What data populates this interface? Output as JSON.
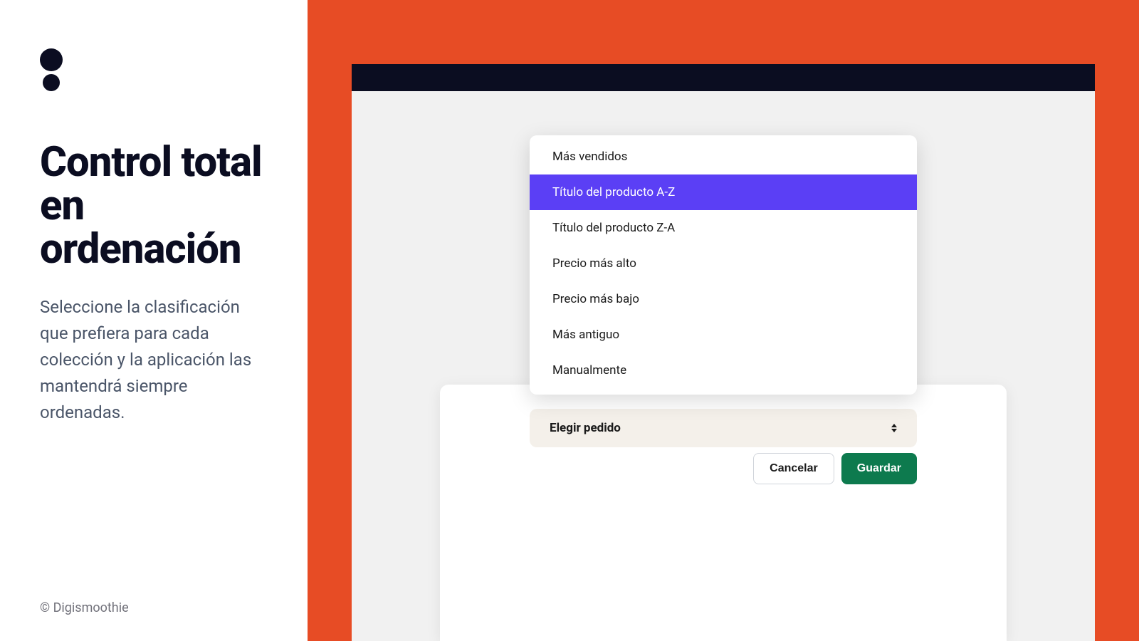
{
  "left": {
    "headline": "Control total en ordenación",
    "description": "Seleccione la clasificación que prefiera para cada colección y la aplicación las mantendrá siempre ordenadas.",
    "copyright": "© Digismoothie"
  },
  "dropdown": {
    "items": [
      "Más vendidos",
      "Título del producto A-Z",
      "Título del producto Z-A",
      "Precio más alto",
      "Precio más bajo",
      "Más antiguo",
      "Manualmente"
    ],
    "selected_index": 1
  },
  "select": {
    "label": "Elegir pedido"
  },
  "buttons": {
    "cancel": "Cancelar",
    "save": "Guardar"
  },
  "colors": {
    "accent_orange": "#e74c25",
    "accent_purple": "#5b3ff5",
    "accent_green": "#0d7a4e",
    "dark": "#0b0d21"
  }
}
